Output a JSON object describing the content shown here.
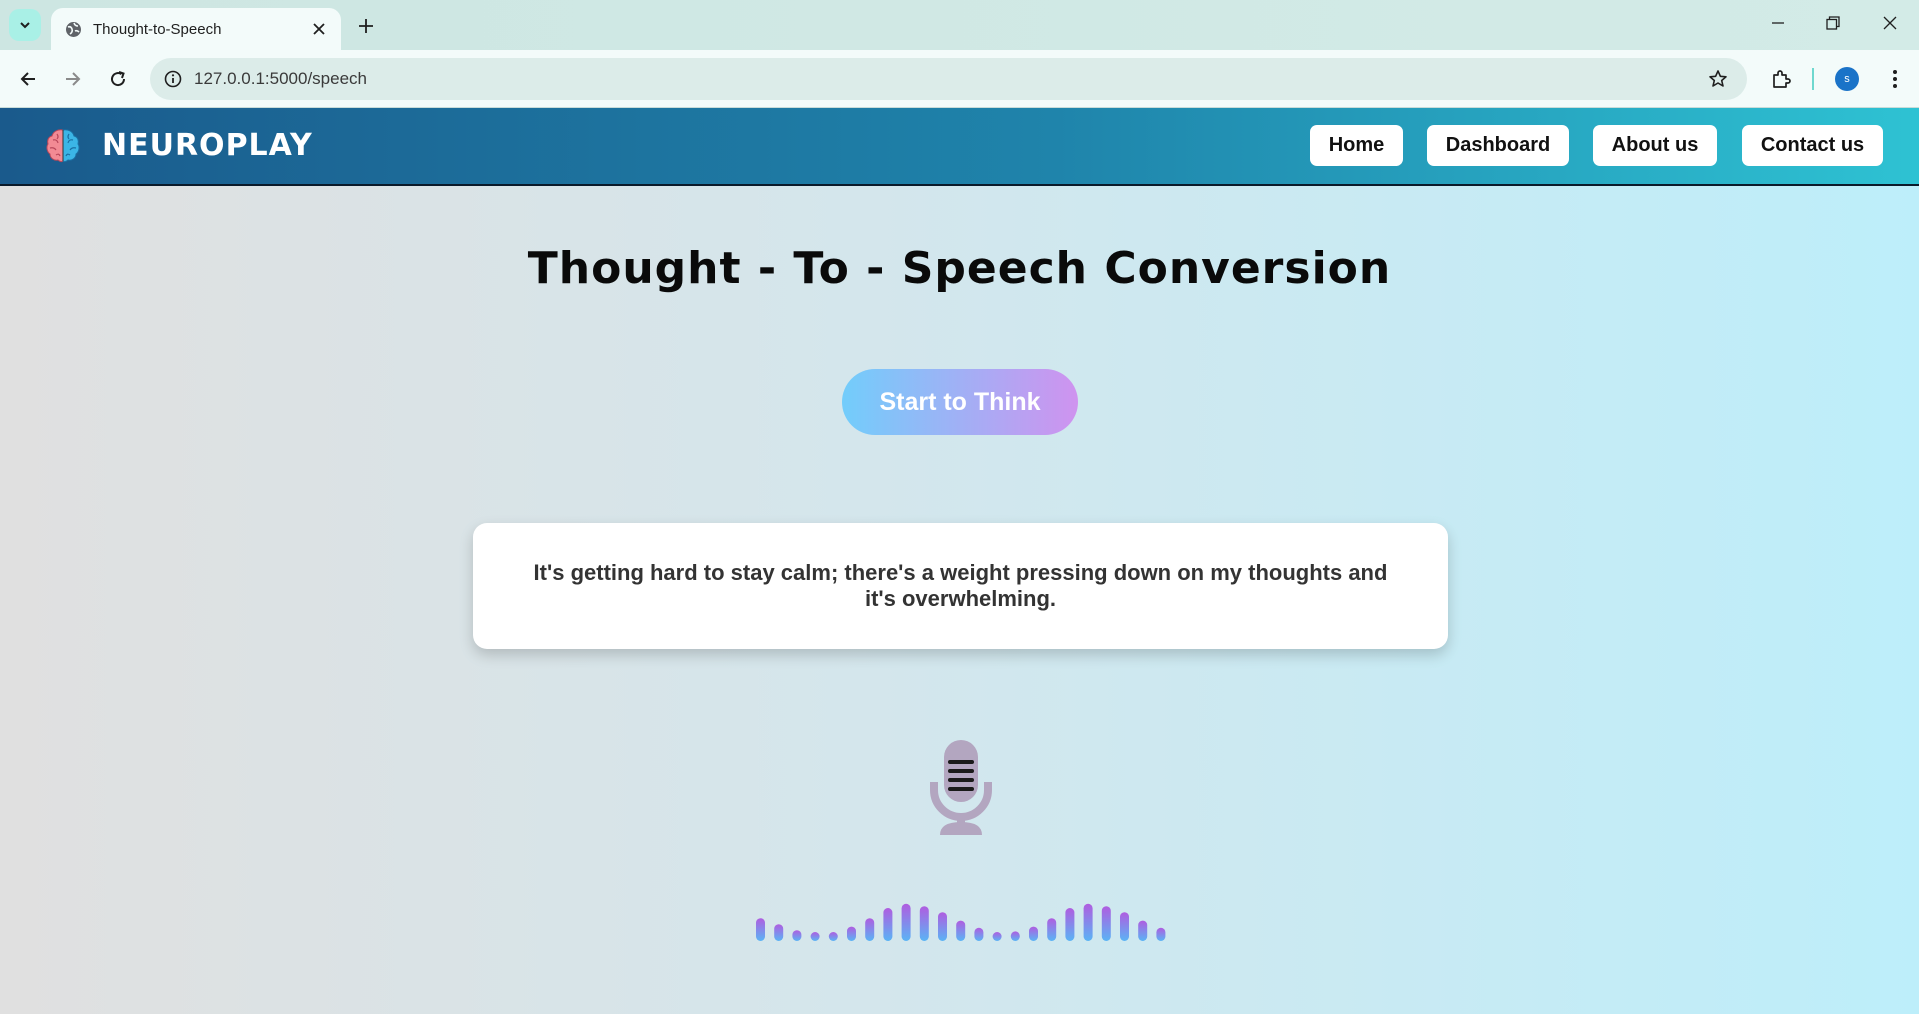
{
  "browser": {
    "tab_title": "Thought-to-Speech",
    "url": "127.0.0.1:5000/speech",
    "profile_initial": "s"
  },
  "navbar": {
    "brand": "NEUROPLAY",
    "links": [
      "Home",
      "Dashboard",
      "About us",
      "Contact us"
    ]
  },
  "main": {
    "title": "Thought - To - Speech Conversion",
    "start_button": "Start to Think",
    "output_text": "It's getting hard to stay calm; there's a weight pressing down on my thoughts and it's overwhelming."
  },
  "icons": {
    "mic": "microphone-icon",
    "brand": "brain-logo-icon"
  },
  "colors": {
    "navbar_start": "#1a5a8c",
    "navbar_end": "#2ec2d3",
    "button_start": "#72cdfb",
    "button_end": "#cf93ef",
    "wave_top": "#b05de0",
    "wave_bottom": "#5ab4f5"
  },
  "waveform_levels": [
    0.38,
    0.28,
    0.18,
    0.12,
    0.15,
    0.24,
    0.38,
    0.55,
    0.62,
    0.58,
    0.48,
    0.34,
    0.22,
    0.14,
    0.16,
    0.24,
    0.38,
    0.55,
    0.62,
    0.58,
    0.48,
    0.34,
    0.22,
    0.14
  ]
}
